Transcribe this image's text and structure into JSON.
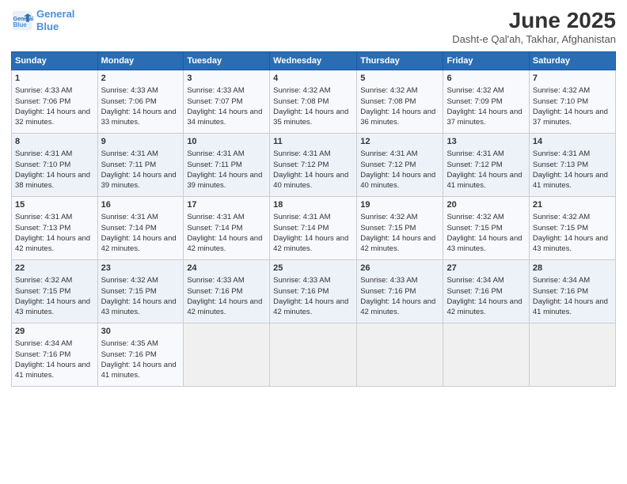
{
  "header": {
    "logo_line1": "General",
    "logo_line2": "Blue",
    "month": "June 2025",
    "location": "Dasht-e Qal'ah, Takhar, Afghanistan"
  },
  "days_of_week": [
    "Sunday",
    "Monday",
    "Tuesday",
    "Wednesday",
    "Thursday",
    "Friday",
    "Saturday"
  ],
  "weeks": [
    [
      {
        "day": "1",
        "sunrise": "4:33 AM",
        "sunset": "7:06 PM",
        "daylight": "14 hours and 32 minutes."
      },
      {
        "day": "2",
        "sunrise": "4:33 AM",
        "sunset": "7:06 PM",
        "daylight": "14 hours and 33 minutes."
      },
      {
        "day": "3",
        "sunrise": "4:33 AM",
        "sunset": "7:07 PM",
        "daylight": "14 hours and 34 minutes."
      },
      {
        "day": "4",
        "sunrise": "4:32 AM",
        "sunset": "7:08 PM",
        "daylight": "14 hours and 35 minutes."
      },
      {
        "day": "5",
        "sunrise": "4:32 AM",
        "sunset": "7:08 PM",
        "daylight": "14 hours and 36 minutes."
      },
      {
        "day": "6",
        "sunrise": "4:32 AM",
        "sunset": "7:09 PM",
        "daylight": "14 hours and 37 minutes."
      },
      {
        "day": "7",
        "sunrise": "4:32 AM",
        "sunset": "7:10 PM",
        "daylight": "14 hours and 37 minutes."
      }
    ],
    [
      {
        "day": "8",
        "sunrise": "4:31 AM",
        "sunset": "7:10 PM",
        "daylight": "14 hours and 38 minutes."
      },
      {
        "day": "9",
        "sunrise": "4:31 AM",
        "sunset": "7:11 PM",
        "daylight": "14 hours and 39 minutes."
      },
      {
        "day": "10",
        "sunrise": "4:31 AM",
        "sunset": "7:11 PM",
        "daylight": "14 hours and 39 minutes."
      },
      {
        "day": "11",
        "sunrise": "4:31 AM",
        "sunset": "7:12 PM",
        "daylight": "14 hours and 40 minutes."
      },
      {
        "day": "12",
        "sunrise": "4:31 AM",
        "sunset": "7:12 PM",
        "daylight": "14 hours and 40 minutes."
      },
      {
        "day": "13",
        "sunrise": "4:31 AM",
        "sunset": "7:12 PM",
        "daylight": "14 hours and 41 minutes."
      },
      {
        "day": "14",
        "sunrise": "4:31 AM",
        "sunset": "7:13 PM",
        "daylight": "14 hours and 41 minutes."
      }
    ],
    [
      {
        "day": "15",
        "sunrise": "4:31 AM",
        "sunset": "7:13 PM",
        "daylight": "14 hours and 42 minutes."
      },
      {
        "day": "16",
        "sunrise": "4:31 AM",
        "sunset": "7:14 PM",
        "daylight": "14 hours and 42 minutes."
      },
      {
        "day": "17",
        "sunrise": "4:31 AM",
        "sunset": "7:14 PM",
        "daylight": "14 hours and 42 minutes."
      },
      {
        "day": "18",
        "sunrise": "4:31 AM",
        "sunset": "7:14 PM",
        "daylight": "14 hours and 42 minutes."
      },
      {
        "day": "19",
        "sunrise": "4:32 AM",
        "sunset": "7:15 PM",
        "daylight": "14 hours and 42 minutes."
      },
      {
        "day": "20",
        "sunrise": "4:32 AM",
        "sunset": "7:15 PM",
        "daylight": "14 hours and 43 minutes."
      },
      {
        "day": "21",
        "sunrise": "4:32 AM",
        "sunset": "7:15 PM",
        "daylight": "14 hours and 43 minutes."
      }
    ],
    [
      {
        "day": "22",
        "sunrise": "4:32 AM",
        "sunset": "7:15 PM",
        "daylight": "14 hours and 43 minutes."
      },
      {
        "day": "23",
        "sunrise": "4:32 AM",
        "sunset": "7:15 PM",
        "daylight": "14 hours and 43 minutes."
      },
      {
        "day": "24",
        "sunrise": "4:33 AM",
        "sunset": "7:16 PM",
        "daylight": "14 hours and 42 minutes."
      },
      {
        "day": "25",
        "sunrise": "4:33 AM",
        "sunset": "7:16 PM",
        "daylight": "14 hours and 42 minutes."
      },
      {
        "day": "26",
        "sunrise": "4:33 AM",
        "sunset": "7:16 PM",
        "daylight": "14 hours and 42 minutes."
      },
      {
        "day": "27",
        "sunrise": "4:34 AM",
        "sunset": "7:16 PM",
        "daylight": "14 hours and 42 minutes."
      },
      {
        "day": "28",
        "sunrise": "4:34 AM",
        "sunset": "7:16 PM",
        "daylight": "14 hours and 41 minutes."
      }
    ],
    [
      {
        "day": "29",
        "sunrise": "4:34 AM",
        "sunset": "7:16 PM",
        "daylight": "14 hours and 41 minutes."
      },
      {
        "day": "30",
        "sunrise": "4:35 AM",
        "sunset": "7:16 PM",
        "daylight": "14 hours and 41 minutes."
      },
      null,
      null,
      null,
      null,
      null
    ]
  ]
}
